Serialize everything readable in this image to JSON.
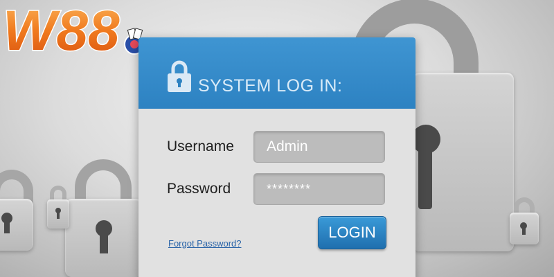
{
  "logo": {
    "text": "W88"
  },
  "login": {
    "title": "SYSTEM LOG IN:",
    "username_label": "Username",
    "username_value": "Admin",
    "password_label": "Password",
    "password_value": "********",
    "forgot_link": "Forgot Password?",
    "login_button": "LOGIN"
  },
  "colors": {
    "header_blue": "#3f95d2",
    "button_blue": "#2a84c4",
    "logo_orange": "#f07a1e",
    "link_blue": "#2a64a8"
  },
  "icons": [
    "padlock-icon",
    "background-padlock-icon",
    "poker-chip-icon"
  ]
}
